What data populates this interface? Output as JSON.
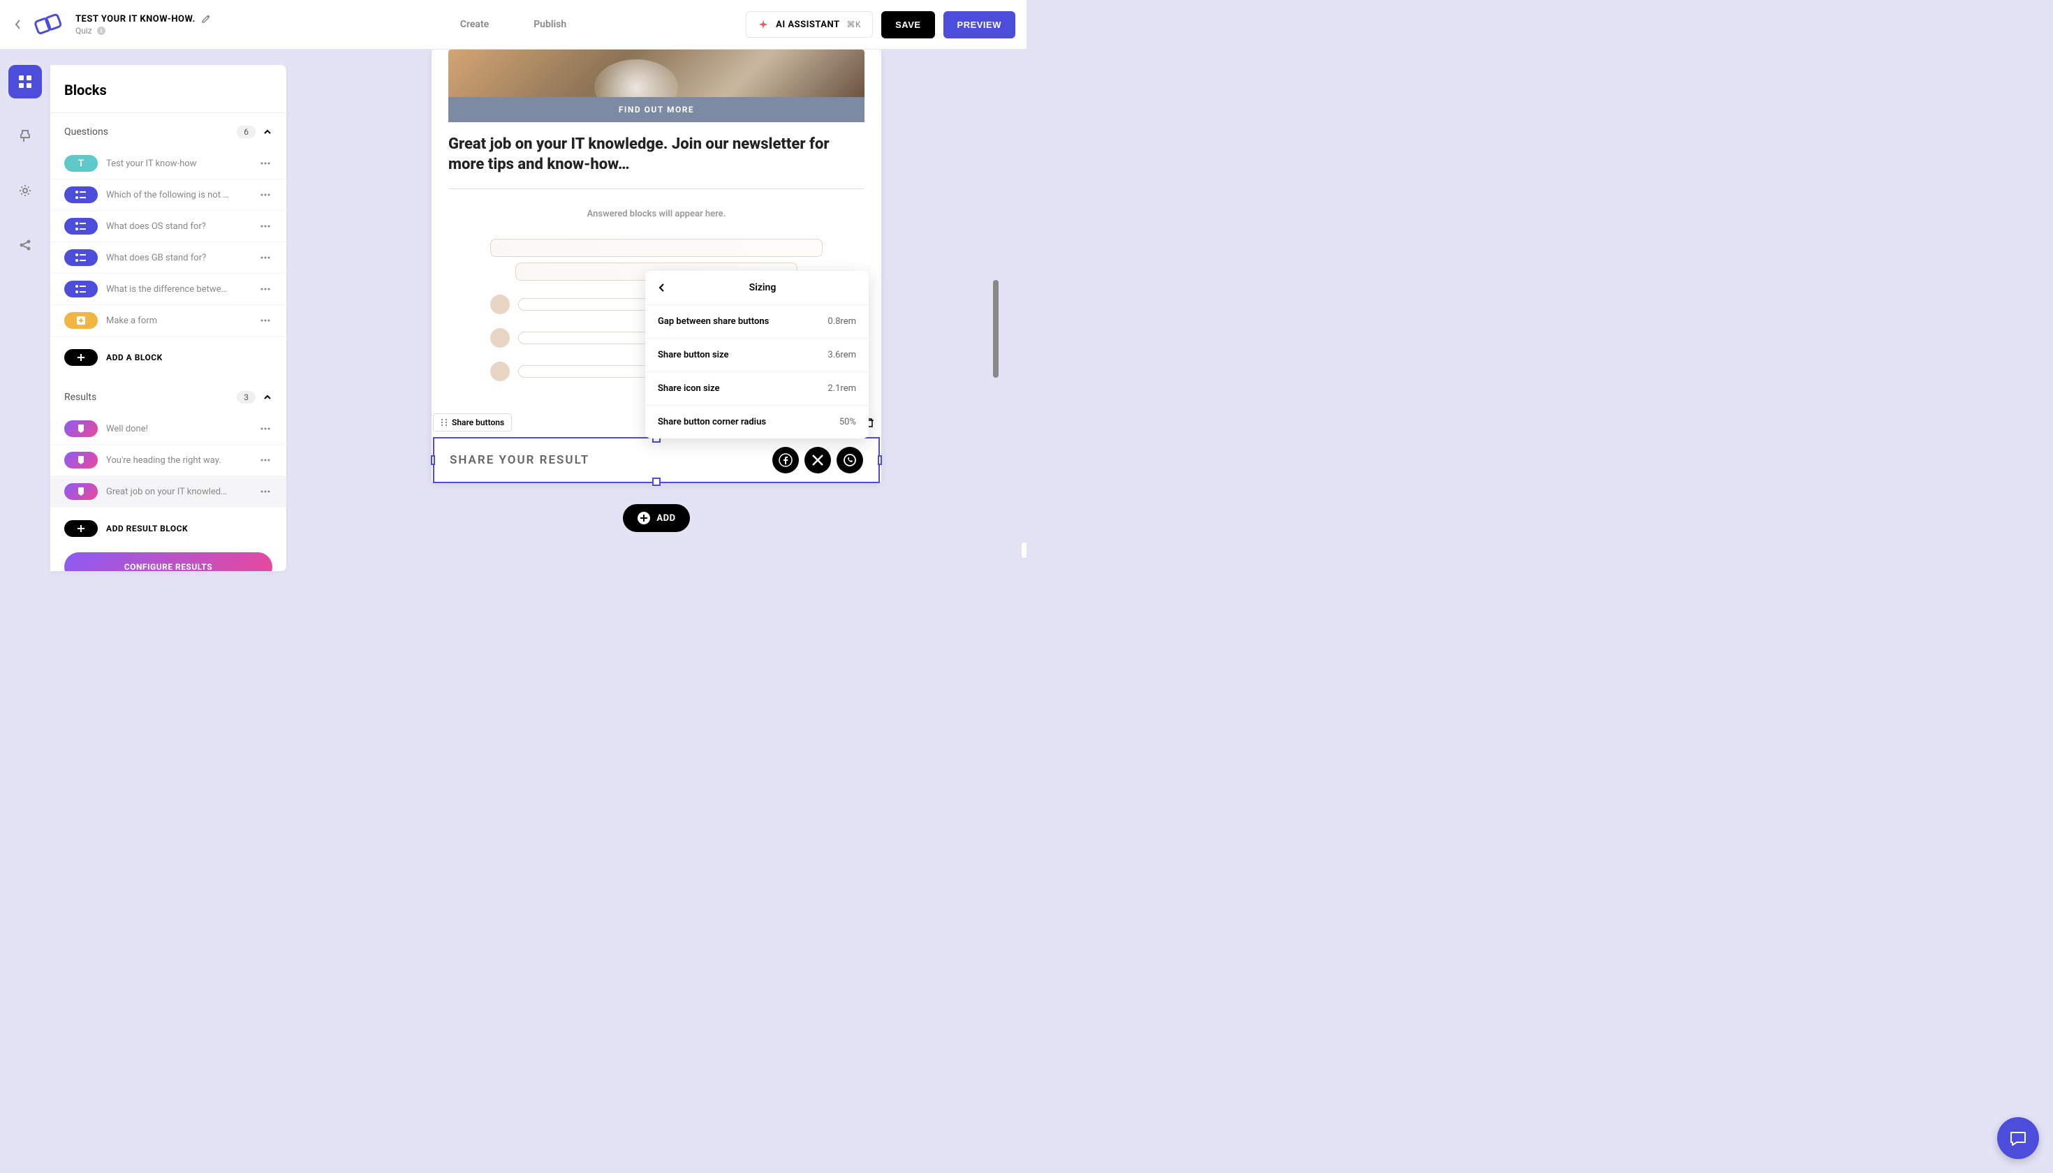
{
  "header": {
    "title": "TEST YOUR IT KNOW-HOW.",
    "subtitle": "Quiz",
    "tabs": {
      "create": "Create",
      "publish": "Publish"
    },
    "ai_label": "AI ASSISTANT",
    "ai_shortcut": "⌘K",
    "save": "SAVE",
    "preview": "PREVIEW"
  },
  "sidebar": {
    "title": "Blocks",
    "questions_label": "Questions",
    "questions_count": "6",
    "results_label": "Results",
    "results_count": "3",
    "questions": [
      {
        "icon": "T",
        "label": "Test your IT know-how"
      },
      {
        "label": "Which of the following is not …"
      },
      {
        "label": "What does OS stand for?"
      },
      {
        "label": "What does GB stand for?"
      },
      {
        "label": "What is the difference betwe…"
      },
      {
        "label": "Make a form"
      }
    ],
    "results": [
      {
        "label": "Well done!"
      },
      {
        "label": "You're heading the right way."
      },
      {
        "label": "Great job on your IT knowled…"
      }
    ],
    "add_block": "ADD A BLOCK",
    "add_result": "ADD RESULT BLOCK",
    "configure": "CONFIGURE RESULTS"
  },
  "canvas": {
    "hero_cta": "FIND OUT MORE",
    "hero_text": "Great job on your IT knowledge. Join our newsletter for more tips and know-how…",
    "answered_hint": "Answered blocks will appear here.",
    "share_block_label": "Share buttons",
    "share_text": "SHARE YOUR RESULT",
    "add_label": "ADD"
  },
  "sizing": {
    "title": "Sizing",
    "rows": [
      {
        "label": "Gap between share buttons",
        "value": "0.8rem"
      },
      {
        "label": "Share button size",
        "value": "3.6rem"
      },
      {
        "label": "Share icon size",
        "value": "2.1rem"
      },
      {
        "label": "Share button corner radius",
        "value": "50%"
      }
    ]
  }
}
